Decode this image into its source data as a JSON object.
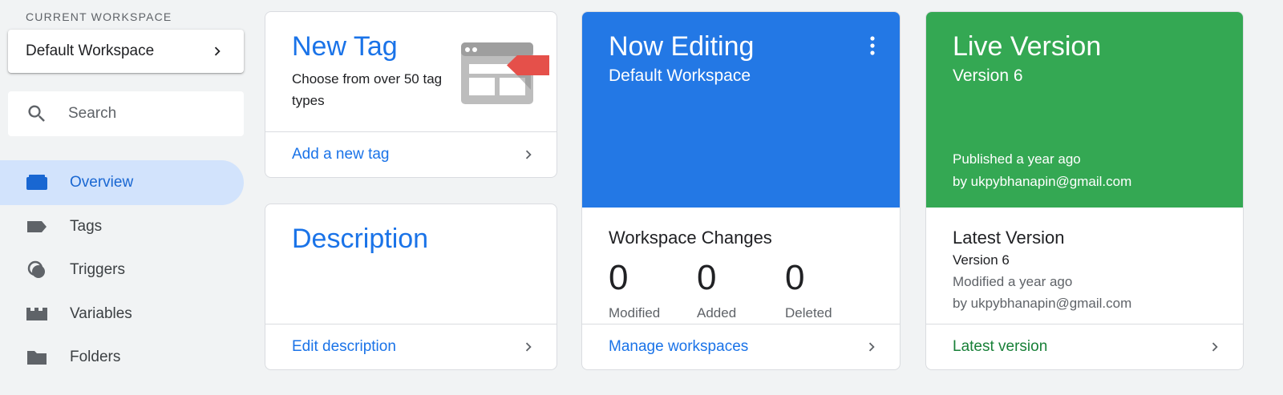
{
  "sidebar": {
    "workspace_label": "CURRENT WORKSPACE",
    "workspace_name": "Default Workspace",
    "search_placeholder": "Search",
    "nav": [
      {
        "label": "Overview",
        "icon": "overview-icon"
      },
      {
        "label": "Tags",
        "icon": "tag-icon"
      },
      {
        "label": "Triggers",
        "icon": "triggers-icon"
      },
      {
        "label": "Variables",
        "icon": "variables-icon"
      },
      {
        "label": "Folders",
        "icon": "folder-icon"
      }
    ]
  },
  "new_tag": {
    "title": "New Tag",
    "description": "Choose from over 50 tag types",
    "link": "Add a new tag"
  },
  "description_card": {
    "title": "Description",
    "link": "Edit description"
  },
  "now_editing": {
    "title": "Now Editing",
    "workspace": "Default Workspace",
    "changes_title": "Workspace Changes",
    "stats": [
      {
        "value": "0",
        "label": "Modified"
      },
      {
        "value": "0",
        "label": "Added"
      },
      {
        "value": "0",
        "label": "Deleted"
      }
    ],
    "link": "Manage workspaces"
  },
  "live_version": {
    "title": "Live Version",
    "version": "Version 6",
    "published": "Published a year ago",
    "published_by": "by ukpybhanapin@gmail.com",
    "latest_title": "Latest Version",
    "latest_version": "Version 6",
    "latest_modified": "Modified a year ago",
    "latest_by": "by ukpybhanapin@gmail.com",
    "link": "Latest version"
  },
  "colors": {
    "accent_blue": "#1a73e8",
    "hero_blue": "#2378e5",
    "hero_green": "#34a853",
    "link_green": "#188038",
    "nav_active_bg": "#d2e3fc"
  }
}
